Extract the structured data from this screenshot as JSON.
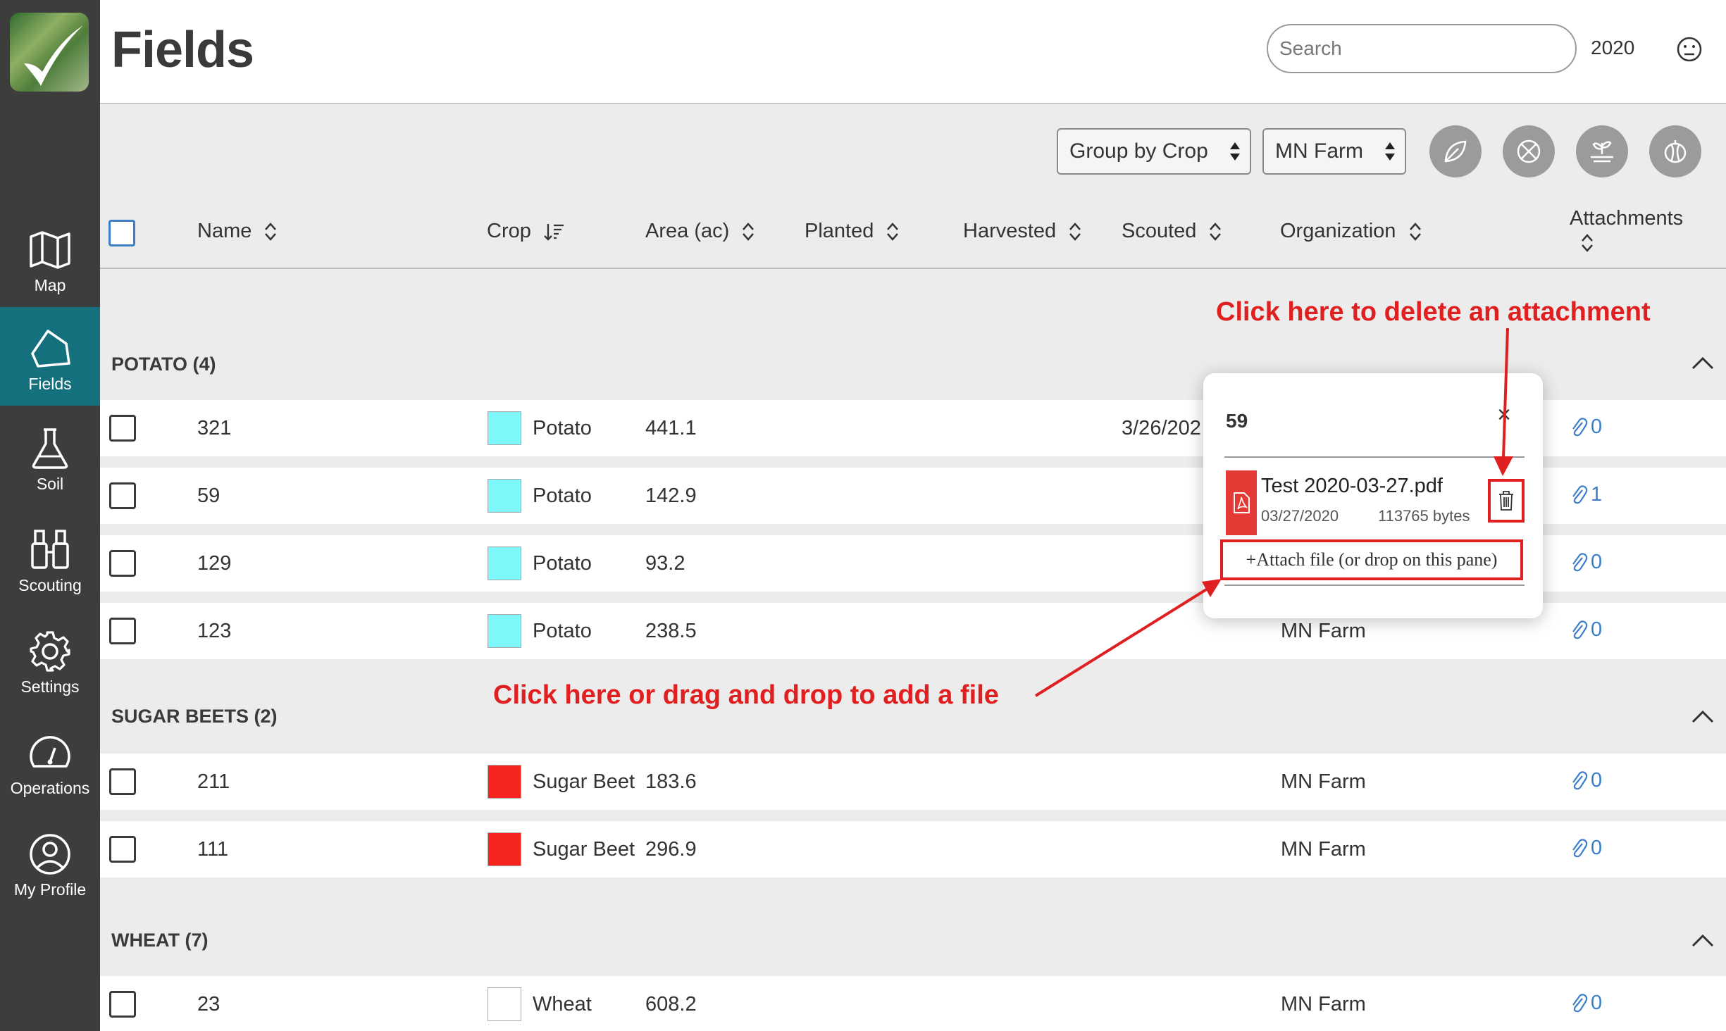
{
  "app": {
    "page_title": "Fields",
    "search_placeholder": "Search",
    "year": "2020"
  },
  "sidebar": {
    "items": [
      {
        "label": "Map",
        "icon": "map-icon",
        "active": false
      },
      {
        "label": "Fields",
        "icon": "fields-icon",
        "active": true
      },
      {
        "label": "Soil",
        "icon": "flask-icon",
        "active": false
      },
      {
        "label": "Scouting",
        "icon": "binoculars-icon",
        "active": false
      },
      {
        "label": "Settings",
        "icon": "gear-icon",
        "active": false
      },
      {
        "label": "Operations",
        "icon": "gauge-icon",
        "active": false
      },
      {
        "label": "My Profile",
        "icon": "user-circle-icon",
        "active": false
      }
    ]
  },
  "toolbar": {
    "group_select": "Group by Crop",
    "farm_select": "MN Farm",
    "action_icons": [
      "leaf-icon",
      "no-spray-icon",
      "planting-icon",
      "harvest-icon"
    ]
  },
  "table": {
    "columns": [
      "Name",
      "Crop",
      "Area (ac)",
      "Planted",
      "Harvested",
      "Scouted",
      "Organization",
      "Attachments"
    ]
  },
  "groups": [
    {
      "title": "POTATO (4)",
      "rows": [
        {
          "name": "321",
          "crop": "Potato",
          "color": "#7ef8fb",
          "area": "441.1",
          "scouted": "3/26/202",
          "org": "",
          "attachments": "0"
        },
        {
          "name": "59",
          "crop": "Potato",
          "color": "#7ef8fb",
          "area": "142.9",
          "scouted": "",
          "org": "",
          "attachments": "1"
        },
        {
          "name": "129",
          "crop": "Potato",
          "color": "#7ef8fb",
          "area": "93.2",
          "scouted": "",
          "org": "",
          "attachments": "0"
        },
        {
          "name": "123",
          "crop": "Potato",
          "color": "#7ef8fb",
          "area": "238.5",
          "scouted": "",
          "org": "MN Farm",
          "attachments": "0"
        }
      ]
    },
    {
      "title": "SUGAR BEETS (2)",
      "rows": [
        {
          "name": "211",
          "crop": "Sugar Beet",
          "color": "#f5251d",
          "area": "183.6",
          "scouted": "",
          "org": "MN Farm",
          "attachments": "0"
        },
        {
          "name": "111",
          "crop": "Sugar Beet",
          "color": "#f5251d",
          "area": "296.9",
          "scouted": "",
          "org": "MN Farm",
          "attachments": "0"
        }
      ]
    },
    {
      "title": "WHEAT (7)",
      "rows": [
        {
          "name": "23",
          "crop": "Wheat",
          "color": "#ffffff",
          "area": "608.2",
          "scouted": "",
          "org": "MN Farm",
          "attachments": "0"
        }
      ]
    }
  ],
  "popover": {
    "title": "59",
    "close": "×",
    "file": {
      "name": "Test 2020-03-27.pdf",
      "date": "03/27/2020",
      "size": "113765 bytes"
    },
    "attach_label": "+Attach file (or drop on this pane)"
  },
  "annotations": {
    "delete_hint": "Click here to delete an attachment",
    "add_hint": "Click here or drag and drop to add a file",
    "color": "#e02020"
  }
}
